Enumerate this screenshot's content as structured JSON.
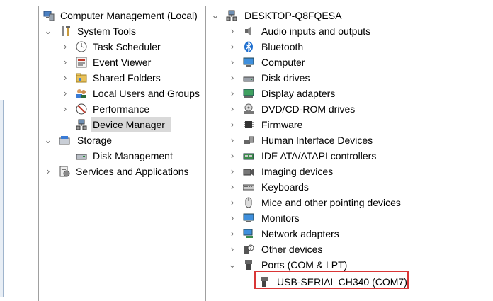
{
  "left_tree": {
    "root": "Computer Management (Local)",
    "system_tools": "System Tools",
    "task_scheduler": "Task Scheduler",
    "event_viewer": "Event Viewer",
    "shared_folders": "Shared Folders",
    "local_users": "Local Users and Groups",
    "performance": "Performance",
    "device_manager": "Device Manager",
    "storage": "Storage",
    "disk_management": "Disk Management",
    "services": "Services and Applications"
  },
  "device_tree": {
    "root": "DESKTOP-Q8FQESA",
    "categories": [
      "Audio inputs and outputs",
      "Bluetooth",
      "Computer",
      "Disk drives",
      "Display adapters",
      "DVD/CD-ROM drives",
      "Firmware",
      "Human Interface Devices",
      "IDE ATA/ATAPI controllers",
      "Imaging devices",
      "Keyboards",
      "Mice and other pointing devices",
      "Monitors",
      "Network adapters",
      "Other devices",
      "Ports (COM & LPT)"
    ],
    "port_device": "USB-SERIAL CH340 (COM7)"
  },
  "colors": {
    "highlight_border": "#d93636",
    "selection": "#d9d9d9"
  }
}
